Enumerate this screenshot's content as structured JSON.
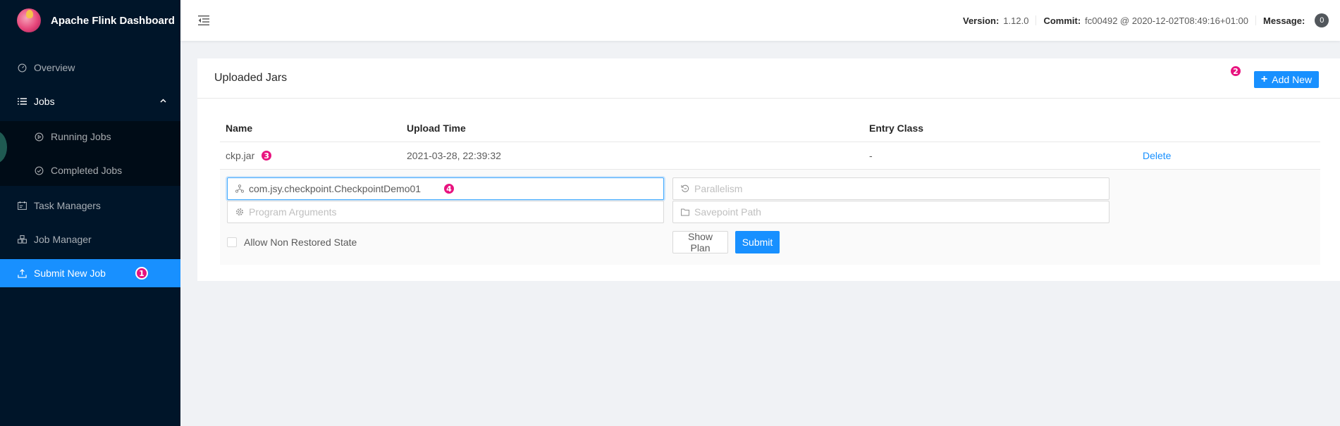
{
  "app": {
    "title": "Apache Flink Dashboard"
  },
  "sidebar": {
    "items": [
      {
        "label": "Overview",
        "icon": "dashboard-icon"
      },
      {
        "label": "Jobs",
        "icon": "list-icon"
      },
      {
        "label": "Running Jobs",
        "icon": "play-circle-icon"
      },
      {
        "label": "Completed Jobs",
        "icon": "check-circle-icon"
      },
      {
        "label": "Task Managers",
        "icon": "schedule-icon"
      },
      {
        "label": "Job Manager",
        "icon": "build-icon"
      },
      {
        "label": "Submit New Job",
        "icon": "upload-icon"
      }
    ],
    "annotation": "1"
  },
  "header": {
    "version_label": "Version:",
    "version_value": "1.12.0",
    "commit_label": "Commit:",
    "commit_value": "fc00492 @ 2020-12-02T08:49:16+01:00",
    "message_label": "Message:",
    "message_count": "0"
  },
  "card": {
    "title": "Uploaded Jars",
    "add_button": "Add New",
    "annotation": "2"
  },
  "table": {
    "headers": [
      "Name",
      "Upload Time",
      "Entry Class",
      ""
    ],
    "rows": [
      {
        "name": "ckp.jar",
        "upload_time": "2021-03-28, 22:39:32",
        "entry_class": "-",
        "action": "Delete",
        "annotation": "3"
      }
    ]
  },
  "form": {
    "entry_class_value": "com.jsy.checkpoint.CheckpointDemo01",
    "entry_class_annotation": "4",
    "parallelism_placeholder": "Parallelism",
    "program_args_placeholder": "Program Arguments",
    "savepoint_placeholder": "Savepoint Path",
    "allow_non_restored": "Allow Non Restored State",
    "show_plan": "Show Plan",
    "submit": "Submit"
  },
  "colors": {
    "sidebar_bg": "#001529",
    "primary": "#1890ff",
    "annotation_badge": "#e8137f"
  }
}
